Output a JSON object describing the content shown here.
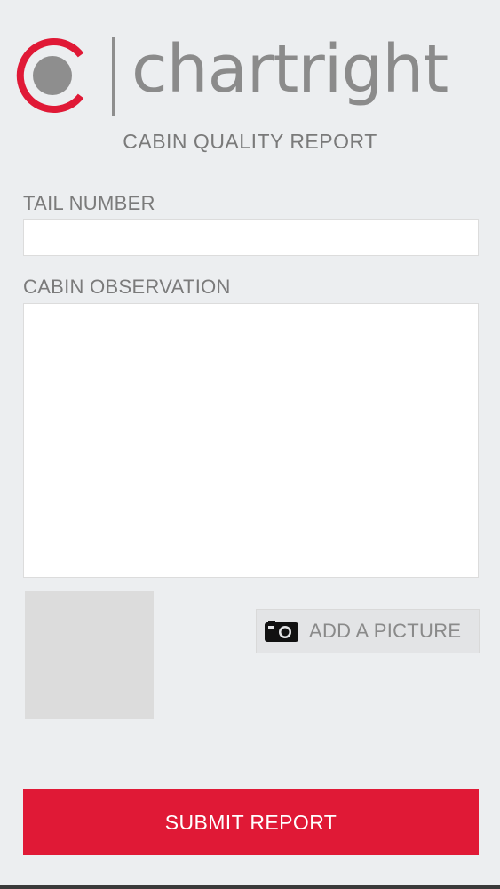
{
  "brand": {
    "name": "chartright",
    "accent_color": "#e01936",
    "mark_color": "#8e8e8e",
    "icon": "chartright-logo-icon"
  },
  "page": {
    "title": "CABIN QUALITY REPORT"
  },
  "form": {
    "tail_number": {
      "label": "TAIL NUMBER",
      "value": "",
      "placeholder": ""
    },
    "cabin_observation": {
      "label": "CABIN OBSERVATION",
      "value": "",
      "placeholder": ""
    },
    "photo": {
      "thumbnail_color": "#dcdcdc"
    },
    "add_picture": {
      "label": "ADD A PICTURE",
      "icon": "camera-icon"
    },
    "submit": {
      "label": "SUBMIT REPORT",
      "color": "#e01936"
    }
  }
}
